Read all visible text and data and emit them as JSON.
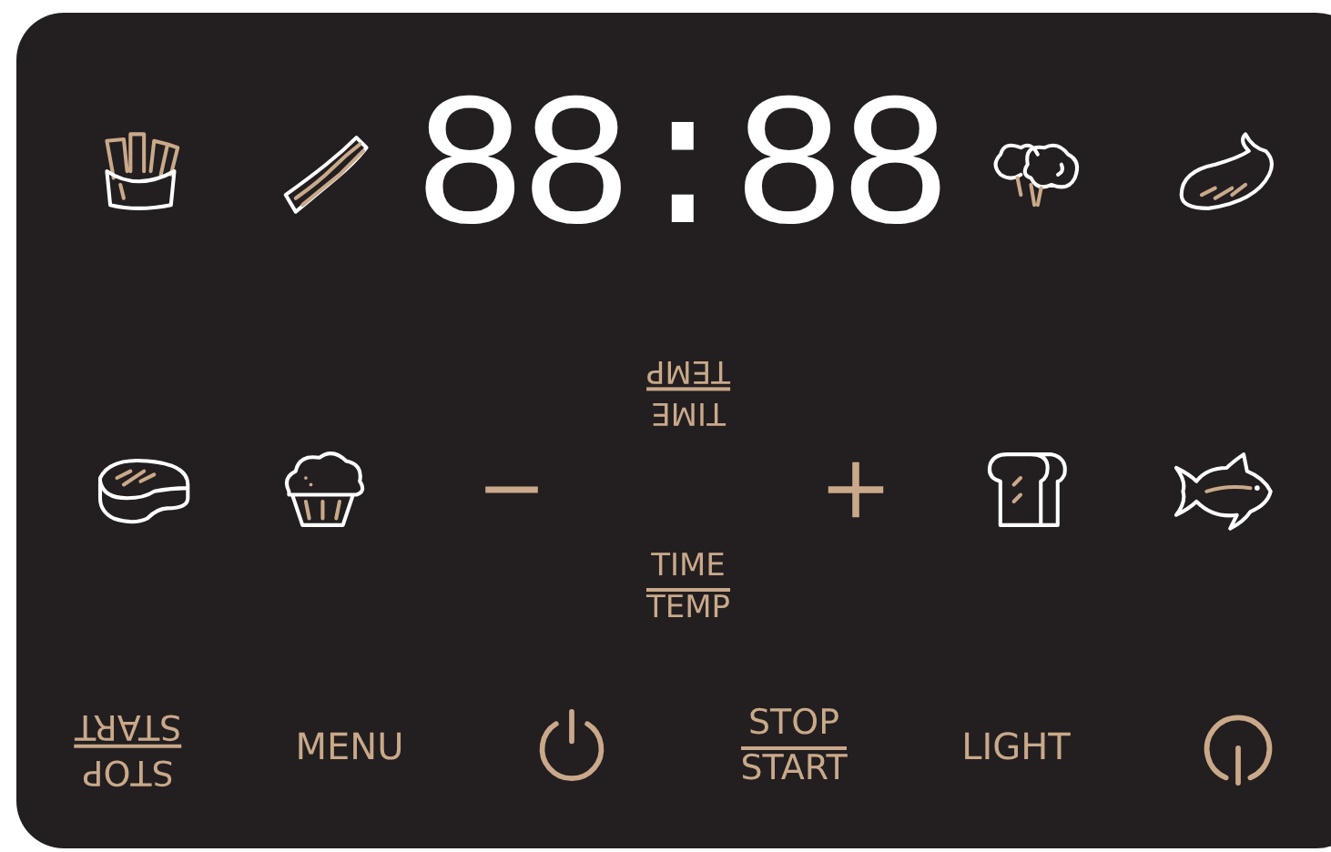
{
  "display": {
    "reading": "88:88"
  },
  "adjust_labels": [
    {
      "top": "TIME",
      "bottom": "TEMP",
      "inverted": true
    },
    {
      "top": "TIME",
      "bottom": "TEMP",
      "inverted": false
    }
  ],
  "bottom_buttons": [
    {
      "kind": "stacked",
      "top": "STOP",
      "bottom": "START",
      "inverted": true
    },
    {
      "kind": "text",
      "label": "MENU"
    },
    {
      "kind": "power"
    },
    {
      "kind": "stacked",
      "top": "STOP",
      "bottom": "START",
      "inverted": false
    },
    {
      "kind": "text",
      "label": "LIGHT"
    },
    {
      "kind": "power-alt"
    }
  ]
}
